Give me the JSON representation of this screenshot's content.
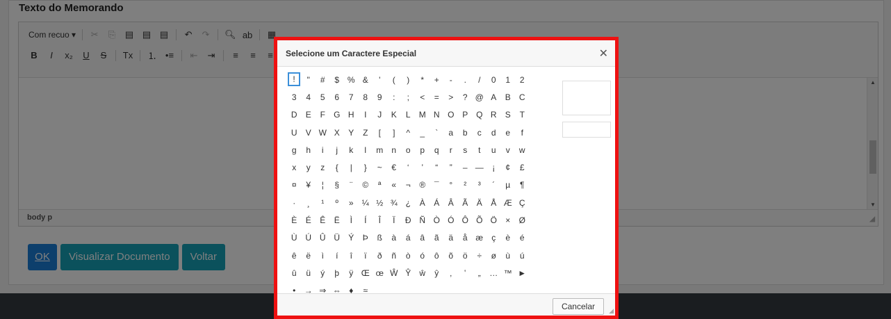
{
  "section": {
    "title": "Texto do Memorando"
  },
  "toolbar": {
    "row1": [
      {
        "name": "format-combo",
        "text": "Com recuo  ▾"
      },
      {
        "name": "sep"
      },
      {
        "name": "cut-icon",
        "text": "✂",
        "dim": true
      },
      {
        "name": "copy-icon",
        "text": "⎘",
        "dim": true
      },
      {
        "name": "paste-icon",
        "text": "▤"
      },
      {
        "name": "paste-text-icon",
        "text": "▤"
      },
      {
        "name": "paste-word-icon",
        "text": "▤"
      },
      {
        "name": "sep"
      },
      {
        "name": "undo-icon",
        "text": "↶"
      },
      {
        "name": "redo-icon",
        "text": "↷",
        "dim": true
      },
      {
        "name": "sep"
      },
      {
        "name": "find-icon",
        "text": "🔍︎"
      },
      {
        "name": "replace-icon",
        "text": "ab"
      },
      {
        "name": "sep"
      },
      {
        "name": "source-icon",
        "text": "▦"
      }
    ],
    "row2": [
      {
        "name": "bold-icon",
        "text": "B"
      },
      {
        "name": "italic-icon",
        "text": "I"
      },
      {
        "name": "subscript-icon",
        "text": "x₂"
      },
      {
        "name": "underline-icon",
        "text": "U"
      },
      {
        "name": "strike-icon",
        "text": "S"
      },
      {
        "name": "sep"
      },
      {
        "name": "remove-format-icon",
        "text": "Tx"
      },
      {
        "name": "sep"
      },
      {
        "name": "numbered-list-icon",
        "text": "⒈"
      },
      {
        "name": "bullet-list-icon",
        "text": "•≡"
      },
      {
        "name": "sep"
      },
      {
        "name": "outdent-icon",
        "text": "⇤",
        "dim": true
      },
      {
        "name": "indent-icon",
        "text": "⇥"
      },
      {
        "name": "sep"
      },
      {
        "name": "align-left-icon",
        "text": "≡"
      },
      {
        "name": "align-center-icon",
        "text": "≡"
      },
      {
        "name": "align-right-icon",
        "text": "≡"
      }
    ]
  },
  "editor": {
    "status_path": "body  p"
  },
  "actions": {
    "ok": "OK",
    "view_document": "Visualizar Documento",
    "back": "Voltar"
  },
  "dialog": {
    "title": "Selecione um Caractere Especial",
    "close": "✕",
    "cancel": "Cancelar",
    "chars": [
      "!",
      "\"",
      "#",
      "$",
      "%",
      "&",
      "'",
      "(",
      ")",
      "*",
      "+",
      "-",
      ".",
      "/",
      "0",
      "1",
      "2",
      "3",
      "4",
      "5",
      "6",
      "7",
      "8",
      "9",
      ":",
      ";",
      "<",
      "=",
      ">",
      "?",
      "@",
      "A",
      "B",
      "C",
      "D",
      "E",
      "F",
      "G",
      "H",
      "I",
      "J",
      "K",
      "L",
      "M",
      "N",
      "O",
      "P",
      "Q",
      "R",
      "S",
      "T",
      "U",
      "V",
      "W",
      "X",
      "Y",
      "Z",
      "[",
      "]",
      "^",
      "_",
      "`",
      "a",
      "b",
      "c",
      "d",
      "e",
      "f",
      "g",
      "h",
      "i",
      "j",
      "k",
      "l",
      "m",
      "n",
      "o",
      "p",
      "q",
      "r",
      "s",
      "t",
      "u",
      "v",
      "w",
      "x",
      "y",
      "z",
      "{",
      "|",
      "}",
      "~",
      "€",
      "‘",
      "’",
      "“",
      "”",
      "–",
      "—",
      "¡",
      "¢",
      "£",
      "¤",
      "¥",
      "¦",
      "§",
      "¨",
      "©",
      "ª",
      "«",
      "¬",
      "®",
      "¯",
      "°",
      "²",
      "³",
      "´",
      "µ",
      "¶",
      "·",
      "¸",
      "¹",
      "º",
      "»",
      "¼",
      "½",
      "¾",
      "¿",
      "À",
      "Á",
      "Â",
      "Ã",
      "Ä",
      "Å",
      "Æ",
      "Ç",
      "È",
      "É",
      "Ê",
      "Ë",
      "Ì",
      "Í",
      "Î",
      "Ï",
      "Ð",
      "Ñ",
      "Ò",
      "Ó",
      "Ô",
      "Õ",
      "Ö",
      "×",
      "Ø",
      "Ù",
      "Ú",
      "Û",
      "Ü",
      "Ý",
      "Þ",
      "ß",
      "à",
      "á",
      "â",
      "ã",
      "ä",
      "å",
      "æ",
      "ç",
      "è",
      "é",
      "ê",
      "ë",
      "ì",
      "í",
      "î",
      "ï",
      "ð",
      "ñ",
      "ò",
      "ó",
      "ô",
      "õ",
      "ö",
      "÷",
      "ø",
      "ù",
      "ú",
      "û",
      "ü",
      "ý",
      "þ",
      "ÿ",
      "Œ",
      "œ",
      "Ŵ",
      "Ŷ",
      "ŵ",
      "ŷ",
      "‚",
      "‛",
      "„",
      "…",
      "™",
      "►",
      "•",
      "→",
      "⇒",
      "⇔",
      "♦",
      "≈"
    ],
    "selected_index": 0
  },
  "colors": {
    "ok_button": "#1a7fd9",
    "teal_button": "#17a2b8",
    "dialog_border": "#ee1111",
    "footer": "#343a40"
  }
}
